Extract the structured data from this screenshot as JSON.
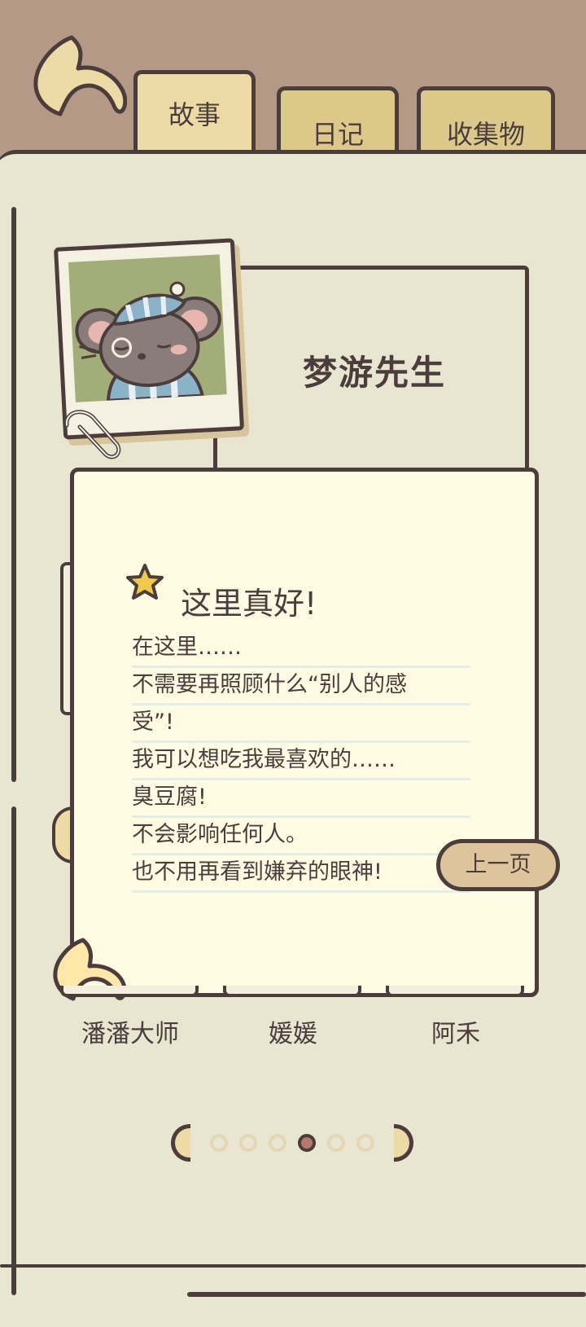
{
  "tabs": [
    {
      "label": "故事",
      "active": true
    },
    {
      "label": "日记",
      "active": false
    },
    {
      "label": "收集物",
      "active": false
    }
  ],
  "character": {
    "name": "梦游先生"
  },
  "note": {
    "title": "这里真好!",
    "lines": [
      "在这里……",
      "不需要再照顾什么“别人的感",
      "受”!",
      "我可以想吃我最喜欢的……",
      "臭豆腐!",
      "不会影响任何人。",
      "也不用再看到嫌弃的眼神!"
    ],
    "prev_button": "上一页"
  },
  "friends": [
    "潘潘大师",
    "媛媛",
    "阿禾"
  ],
  "pagination": {
    "total": 6,
    "current": 4
  },
  "colors": {
    "accent": "#ecdba5",
    "outline": "#4b3d3c",
    "paper": "#fffce3",
    "page": "#e8e5d1",
    "header": "#b49a86"
  }
}
